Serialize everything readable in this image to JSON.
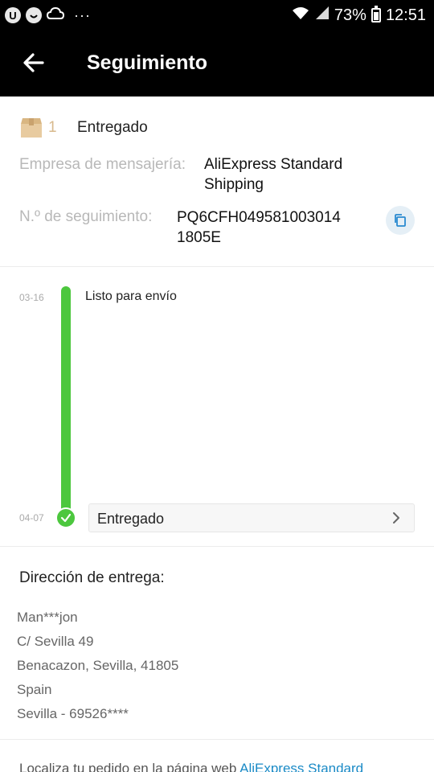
{
  "status_bar": {
    "icons": [
      "u-badge-icon",
      "smiley-icon",
      "cloud-icon"
    ],
    "more": "···",
    "battery": "73%",
    "time": "12:51"
  },
  "header": {
    "title": "Seguimiento"
  },
  "summary": {
    "package_count": "1",
    "status": "Entregado",
    "courier_label": "Empresa de mensajería:",
    "courier_value_line1": "AliExpress Standard",
    "courier_value_line2": "Shipping",
    "tracking_label": "N.º de seguimiento:",
    "tracking_value_line1": "PQ6CFH049581003014",
    "tracking_value_line2": "1805E"
  },
  "timeline": {
    "events": [
      {
        "date": "03-16",
        "label": "Listo para envío"
      },
      {
        "date": "04-07",
        "label": "Entregado"
      }
    ]
  },
  "address": {
    "title": "Dirección de entrega:",
    "lines": [
      "Man***jon",
      "C/ Sevilla 49",
      "Benacazon, Sevilla, 41805",
      "Spain",
      "Sevilla - 69526****"
    ]
  },
  "footer": {
    "text": "Localiza tu pedido en la página web ",
    "link": "AliExpress Standard"
  },
  "colors": {
    "timeline_green": "#4cc73e",
    "link_blue": "#1a8ac6",
    "package_tan": "#d8b98d"
  }
}
